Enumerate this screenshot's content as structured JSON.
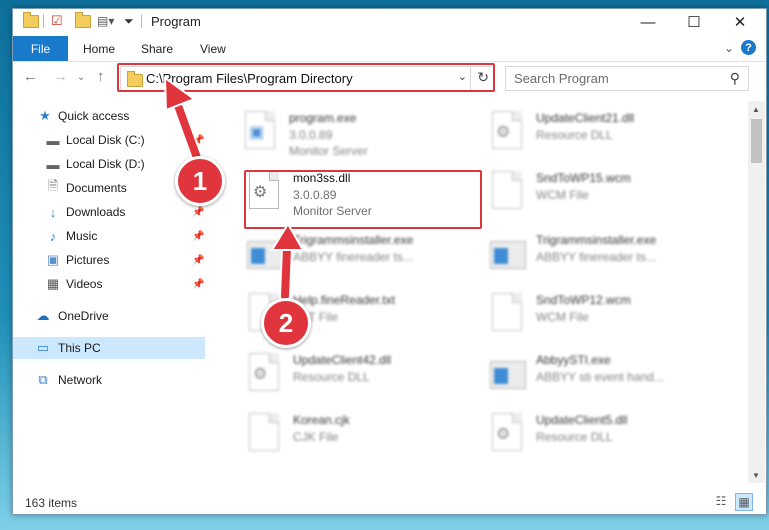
{
  "window": {
    "title": "Program",
    "controls": {
      "minimize": "—",
      "maximize": "☐",
      "close": "✕"
    }
  },
  "ribbon": {
    "tabs": [
      "File",
      "Home",
      "Share",
      "View"
    ],
    "help": "?"
  },
  "address": {
    "path": "C:\\Program Files\\Program Directory",
    "search_placeholder": "Search Program"
  },
  "sidebar": {
    "items": [
      {
        "label": "Quick access",
        "icon": "star-icon"
      },
      {
        "label": "Local Disk (C:)",
        "icon": "drive-icon",
        "pinned": true
      },
      {
        "label": "Local Disk (D:)",
        "icon": "drive-icon"
      },
      {
        "label": "Documents",
        "icon": "documents-icon",
        "pinned": true
      },
      {
        "label": "Downloads",
        "icon": "download-icon",
        "pinned": true
      },
      {
        "label": "Music",
        "icon": "music-icon",
        "pinned": true
      },
      {
        "label": "Pictures",
        "icon": "pictures-icon",
        "pinned": true
      },
      {
        "label": "Videos",
        "icon": "videos-icon",
        "pinned": true
      },
      {
        "label": "OneDrive",
        "icon": "cloud-icon"
      },
      {
        "label": "This PC",
        "icon": "pc-icon",
        "selected": true
      },
      {
        "label": "Network",
        "icon": "network-icon"
      }
    ]
  },
  "files": [
    {
      "name": "program.exe",
      "line2": "3.0.0.89",
      "line3": "Monitor Server",
      "kind": "exe"
    },
    {
      "name": "UpdateClient21.dll",
      "line2": "Resource DLL",
      "line3": "",
      "kind": "dll"
    },
    {
      "name": "mon3ss.dll",
      "line2": "3.0.0.89",
      "line3": "Monitor Server",
      "kind": "dll",
      "highlight": true
    },
    {
      "name": "SndToWP15.wcm",
      "line2": "WCM File",
      "line3": "",
      "kind": "doc"
    },
    {
      "name": "Trigrammsinstaller.exe",
      "line2": "ABBYY finereader ts...",
      "line3": "",
      "kind": "app"
    },
    {
      "name": "Trigrammsinstaller.exe",
      "line2": "ABBYY finereader ts...",
      "line3": "",
      "kind": "app"
    },
    {
      "name": "Help.fineReader.txt",
      "line2": "TXT File",
      "line3": "",
      "kind": "doc"
    },
    {
      "name": "SndToWP12.wcm",
      "line2": "WCM File",
      "line3": "",
      "kind": "doc"
    },
    {
      "name": "UpdateClient42.dll",
      "line2": "Resource DLL",
      "line3": "",
      "kind": "dll"
    },
    {
      "name": "AbbyySTI.exe",
      "line2": "ABBYY sti event hand...",
      "line3": "",
      "kind": "app"
    },
    {
      "name": "Korean.cjk",
      "line2": "CJK File",
      "line3": "",
      "kind": "doc"
    },
    {
      "name": "UpdateClient5.dll",
      "line2": "Resource DLL",
      "line3": "",
      "kind": "dll"
    }
  ],
  "status": {
    "count": "163 items"
  },
  "annotations": {
    "one": "1",
    "two": "2"
  },
  "colors": {
    "accent": "#1979ca",
    "annotation": "#e0353d",
    "selection": "#cce8ff"
  }
}
